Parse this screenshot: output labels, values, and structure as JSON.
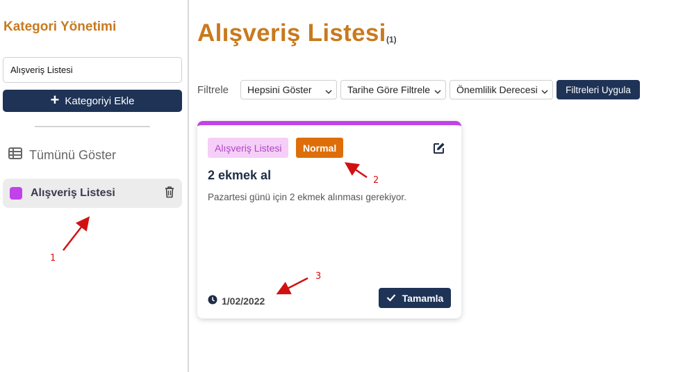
{
  "sidebar": {
    "title": "Kategori Yönetimi",
    "category_input_value": "Alışveriş Listesi",
    "add_button_label": "Kategoriyi Ekle",
    "show_all_label": "Tümünü Göster",
    "categories": [
      {
        "label": "Alışveriş Listesi",
        "color": "#c142e8"
      }
    ]
  },
  "main": {
    "title": "Alışveriş Listesi",
    "count": "(1)"
  },
  "filters": {
    "label": "Filtrele",
    "select_1": "Hepsini Göster",
    "select_2": "Tarihe Göre Filtrele",
    "select_3": "Önemlilik Derecesi",
    "apply_label": "Filtreleri Uygula"
  },
  "task": {
    "category_badge": "Alışveriş Listesi",
    "priority_badge": "Normal",
    "title": "2 ekmek al",
    "description": "Pazartesi günü için 2 ekmek alınması gerekiyor.",
    "date": "1/02/2022",
    "complete_label": "Tamamla"
  },
  "annotations": {
    "label_1": "1",
    "label_2": "2",
    "label_3": "3"
  },
  "colors": {
    "accent": "#c87a1e",
    "navy": "#1e3356",
    "category_purple": "#c142e8",
    "priority_orange": "#dd6e09",
    "annotation_red": "#d11111"
  }
}
